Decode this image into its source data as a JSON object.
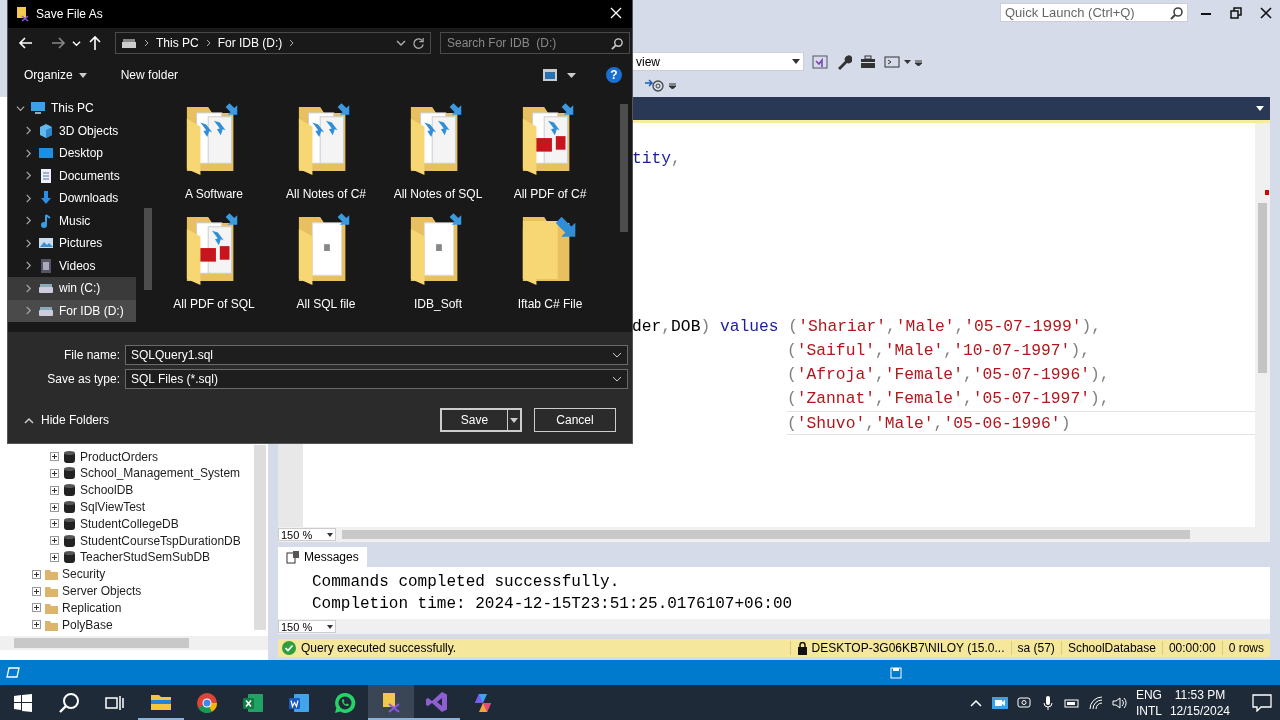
{
  "dialog": {
    "title": "Save File As",
    "breadcrumb": [
      "This PC",
      "For IDB  (D:)"
    ],
    "search": {
      "placeholder": "Search For IDB  (D:)"
    },
    "toolbar": {
      "organize": "Organize",
      "new_folder": "New folder",
      "help": "?"
    },
    "nav": [
      {
        "label": "This PC",
        "kind": "pc",
        "expanded": true,
        "selected": false,
        "hovered": false,
        "children": [
          {
            "label": "3D Objects",
            "kind": "objects",
            "expanded": false,
            "selected": false,
            "hovered": false
          },
          {
            "label": "Desktop",
            "kind": "desktop",
            "expanded": false,
            "selected": false,
            "hovered": false
          },
          {
            "label": "Documents",
            "kind": "documents",
            "expanded": false,
            "selected": false,
            "hovered": false
          },
          {
            "label": "Downloads",
            "kind": "downloads",
            "expanded": false,
            "selected": false,
            "hovered": false
          },
          {
            "label": "Music",
            "kind": "music",
            "expanded": false,
            "selected": false,
            "hovered": false
          },
          {
            "label": "Pictures",
            "kind": "pictures",
            "expanded": false,
            "selected": false,
            "hovered": false
          },
          {
            "label": "Videos",
            "kind": "videos",
            "expanded": false,
            "selected": false,
            "hovered": false
          },
          {
            "label": "win (C:)",
            "kind": "drive",
            "expanded": false,
            "selected": false,
            "hovered": true
          },
          {
            "label": "For IDB  (D:)",
            "kind": "drive",
            "expanded": false,
            "selected": true,
            "hovered": false
          }
        ]
      }
    ],
    "folders": [
      {
        "name": "A Software",
        "kind": "notes"
      },
      {
        "name": "All Notes of C#",
        "kind": "notes"
      },
      {
        "name": "All Notes of SQL",
        "kind": "notes"
      },
      {
        "name": "All PDF of C#",
        "kind": "pdf"
      },
      {
        "name": "All PDF of SQL",
        "kind": "pdf"
      },
      {
        "name": "All SQL file",
        "kind": "single"
      },
      {
        "name": "IDB_Soft",
        "kind": "single"
      },
      {
        "name": "Iftab C# File",
        "kind": "empty"
      }
    ],
    "file_name": {
      "label": "File name:",
      "value": "SQLQuery1.sql"
    },
    "save_type": {
      "label": "Save as type:",
      "value": "SQL Files (*.sql)"
    },
    "hide_folders": "Hide Folders",
    "save": "Save",
    "cancel": "Cancel"
  },
  "quick_launch": {
    "placeholder": "Quick Launch (Ctrl+Q)"
  },
  "database_combo": "view",
  "object_explorer": {
    "databases": [
      "ProductOrders",
      "School_Management_System",
      "SchoolDB",
      "SqlViewTest",
      "StudentCollegeDB",
      "StudentCourseTspDurationDB",
      "TeacherStudSemSubDB"
    ],
    "folders": [
      "Security",
      "Server Objects",
      "Replication",
      "PolyBase"
    ]
  },
  "editor": {
    "zoom": "150 %",
    "lines": [
      {
        "indent": false,
        "current": false,
        "tokens": [
          {
            "kind": "keyword",
            "text": "tity"
          },
          {
            "kind": "punct",
            "text": ","
          }
        ]
      },
      {
        "indent": false,
        "current": false,
        "tokens": [
          {
            "kind": "plain",
            "text": "der"
          },
          {
            "kind": "punct",
            "text": ","
          },
          {
            "kind": "plain",
            "text": "DOB"
          },
          {
            "kind": "punct",
            "text": ") "
          },
          {
            "kind": "keyword",
            "text": "values"
          },
          {
            "kind": "punct",
            "text": " ("
          },
          {
            "kind": "string",
            "text": "'Shariar'"
          },
          {
            "kind": "punct",
            "text": ","
          },
          {
            "kind": "string",
            "text": "'Male'"
          },
          {
            "kind": "punct",
            "text": ","
          },
          {
            "kind": "string",
            "text": "'05-07-1999'"
          },
          {
            "kind": "punct",
            "text": "),"
          }
        ]
      },
      {
        "indent": true,
        "current": false,
        "tokens": [
          {
            "kind": "punct",
            "text": "("
          },
          {
            "kind": "string",
            "text": "'Saiful'"
          },
          {
            "kind": "punct",
            "text": ","
          },
          {
            "kind": "string",
            "text": "'Male'"
          },
          {
            "kind": "punct",
            "text": ","
          },
          {
            "kind": "string",
            "text": "'10-07-1997'"
          },
          {
            "kind": "punct",
            "text": "),"
          }
        ]
      },
      {
        "indent": true,
        "current": false,
        "tokens": [
          {
            "kind": "punct",
            "text": "("
          },
          {
            "kind": "string",
            "text": "'Afroja'"
          },
          {
            "kind": "punct",
            "text": ","
          },
          {
            "kind": "string",
            "text": "'Female'"
          },
          {
            "kind": "punct",
            "text": ","
          },
          {
            "kind": "string",
            "text": "'05-07-1996'"
          },
          {
            "kind": "punct",
            "text": "),"
          }
        ]
      },
      {
        "indent": true,
        "current": false,
        "tokens": [
          {
            "kind": "punct",
            "text": "("
          },
          {
            "kind": "string",
            "text": "'Zannat'"
          },
          {
            "kind": "punct",
            "text": ","
          },
          {
            "kind": "string",
            "text": "'Female'"
          },
          {
            "kind": "punct",
            "text": ","
          },
          {
            "kind": "string",
            "text": "'05-07-1997'"
          },
          {
            "kind": "punct",
            "text": "),"
          }
        ]
      },
      {
        "indent": true,
        "current": true,
        "tokens": [
          {
            "kind": "punct",
            "text": "("
          },
          {
            "kind": "string",
            "text": "'Shuvo'"
          },
          {
            "kind": "punct",
            "text": ","
          },
          {
            "kind": "string",
            "text": "'Male'"
          },
          {
            "kind": "punct",
            "text": ","
          },
          {
            "kind": "string",
            "text": "'05-06-1996'"
          },
          {
            "kind": "punct",
            "text": ")"
          }
        ]
      }
    ]
  },
  "messages": {
    "tab": "Messages",
    "zoom": "150 %",
    "lines": [
      "Commands completed successfully.",
      "Completion time: 2024-12-15T23:51:25.0176107+06:00"
    ]
  },
  "status_bar": {
    "message": "Query executed successfully.",
    "server": "DESKTOP-3G06KB7\\NILOY (15.0...",
    "user": "sa (57)",
    "database": "SchoolDatabase",
    "elapsed": "00:00:00",
    "rows": "0 rows"
  },
  "taskbar": {
    "apps": [
      {
        "kind": "explorer",
        "running": true,
        "active": false
      },
      {
        "kind": "browser",
        "running": false,
        "active": false
      },
      {
        "kind": "spreadsheet",
        "running": false,
        "active": false
      },
      {
        "kind": "word",
        "running": false,
        "active": false
      },
      {
        "kind": "chat",
        "running": false,
        "active": false
      },
      {
        "kind": "ssms",
        "running": true,
        "active": true
      },
      {
        "kind": "vs",
        "running": true,
        "active": false
      },
      {
        "kind": "assistant",
        "running": false,
        "active": false
      }
    ],
    "language": "ENG",
    "layout": "INTL",
    "time": "11:53 PM",
    "date": "12/15/2024"
  }
}
